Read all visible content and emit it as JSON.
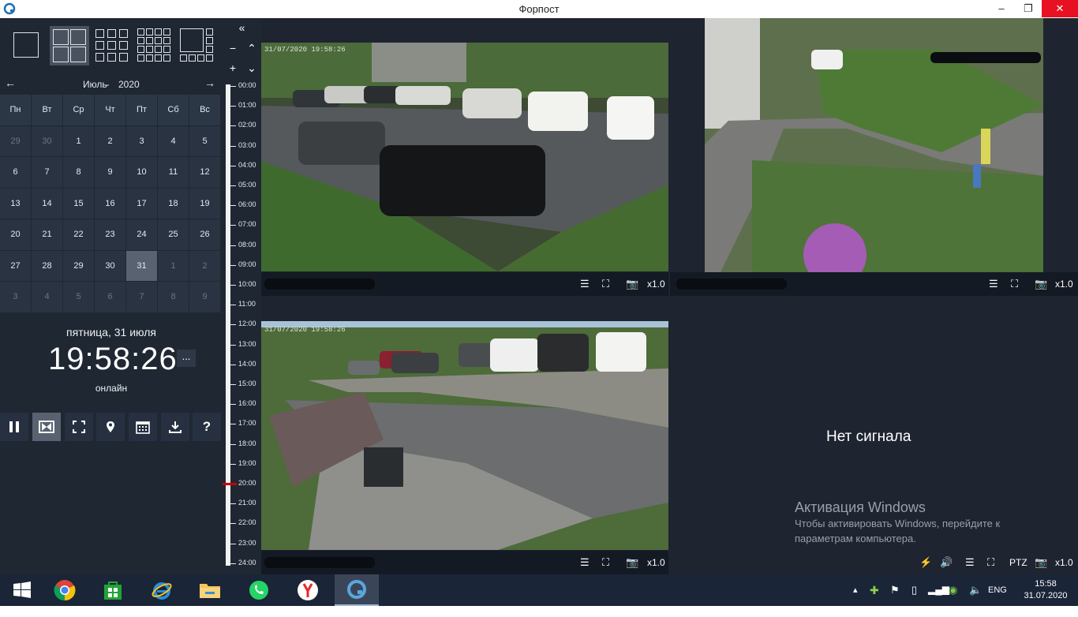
{
  "window": {
    "title": "Форпост",
    "app_icon": "forpost-logo-icon",
    "minimize_icon": "minimize-icon",
    "maximize_icon": "restore-icon",
    "close_icon": "close-icon"
  },
  "sidebar": {
    "collapse_label": "«",
    "layouts": [
      "single-view-icon",
      "2x2-grid-icon",
      "3x3-grid-icon",
      "4x4-grid-icon",
      "mixed-layout-icon"
    ],
    "active_layout": "2x2-grid-icon"
  },
  "calendar": {
    "month": "Июль",
    "year": "2020",
    "weekdays": [
      "Пн",
      "Вт",
      "Ср",
      "Чт",
      "Пт",
      "Сб",
      "Вс"
    ],
    "weeks": [
      [
        "29",
        "30",
        "1",
        "2",
        "3",
        "4",
        "5"
      ],
      [
        "6",
        "7",
        "8",
        "9",
        "10",
        "11",
        "12"
      ],
      [
        "13",
        "14",
        "15",
        "16",
        "17",
        "18",
        "19"
      ],
      [
        "20",
        "21",
        "22",
        "23",
        "24",
        "25",
        "26"
      ],
      [
        "27",
        "28",
        "29",
        "30",
        "31",
        "1",
        "2"
      ],
      [
        "3",
        "4",
        "5",
        "6",
        "7",
        "8",
        "9"
      ]
    ],
    "selected": "31"
  },
  "status": {
    "date_line": "пятница, 31 июля",
    "time": "19:58:26",
    "more": "...",
    "mode": "онлайн"
  },
  "toolbar": [
    "pause-icon",
    "compare-icon",
    "fullscreen-icon",
    "location-pin-icon",
    "calendar-icon",
    "download-icon",
    "help-icon"
  ],
  "timeline": {
    "zoom_minus": "−",
    "zoom_plus": "+",
    "hours": [
      "00:00",
      "01:00",
      "02:00",
      "03:00",
      "04:00",
      "05:00",
      "06:00",
      "07:00",
      "08:00",
      "09:00",
      "10:00",
      "11:00",
      "12:00",
      "13:00",
      "14:00",
      "15:00",
      "16:00",
      "17:00",
      "18:00",
      "19:00",
      "20:00",
      "21:00",
      "22:00",
      "23:00",
      "24:00"
    ],
    "current_position_hours": 20.0
  },
  "cameras": [
    {
      "id": "cam1",
      "timestamp": "31/07/2020 19:58:26",
      "speed": "x1.0"
    },
    {
      "id": "cam2",
      "speed": "x1.0"
    },
    {
      "id": "cam3",
      "timestamp": "31/07/2020 19:58:26",
      "speed": "x1.0"
    },
    {
      "id": "cam4",
      "no_signal": "Нет сигнала",
      "ptz": "PTZ",
      "speed": "x1.0"
    }
  ],
  "watermark": {
    "title": "Активация Windows",
    "line1": "Чтобы активировать Windows, перейдите к",
    "line2": "параметрам компьютера."
  },
  "taskbar": {
    "apps": [
      "windows-start-icon",
      "chrome-icon",
      "store-icon",
      "ie-icon",
      "explorer-icon",
      "whatsapp-icon",
      "yandex-icon",
      "forpost-icon"
    ],
    "lang": "ENG",
    "time": "15:58",
    "date": "31.07.2020"
  }
}
